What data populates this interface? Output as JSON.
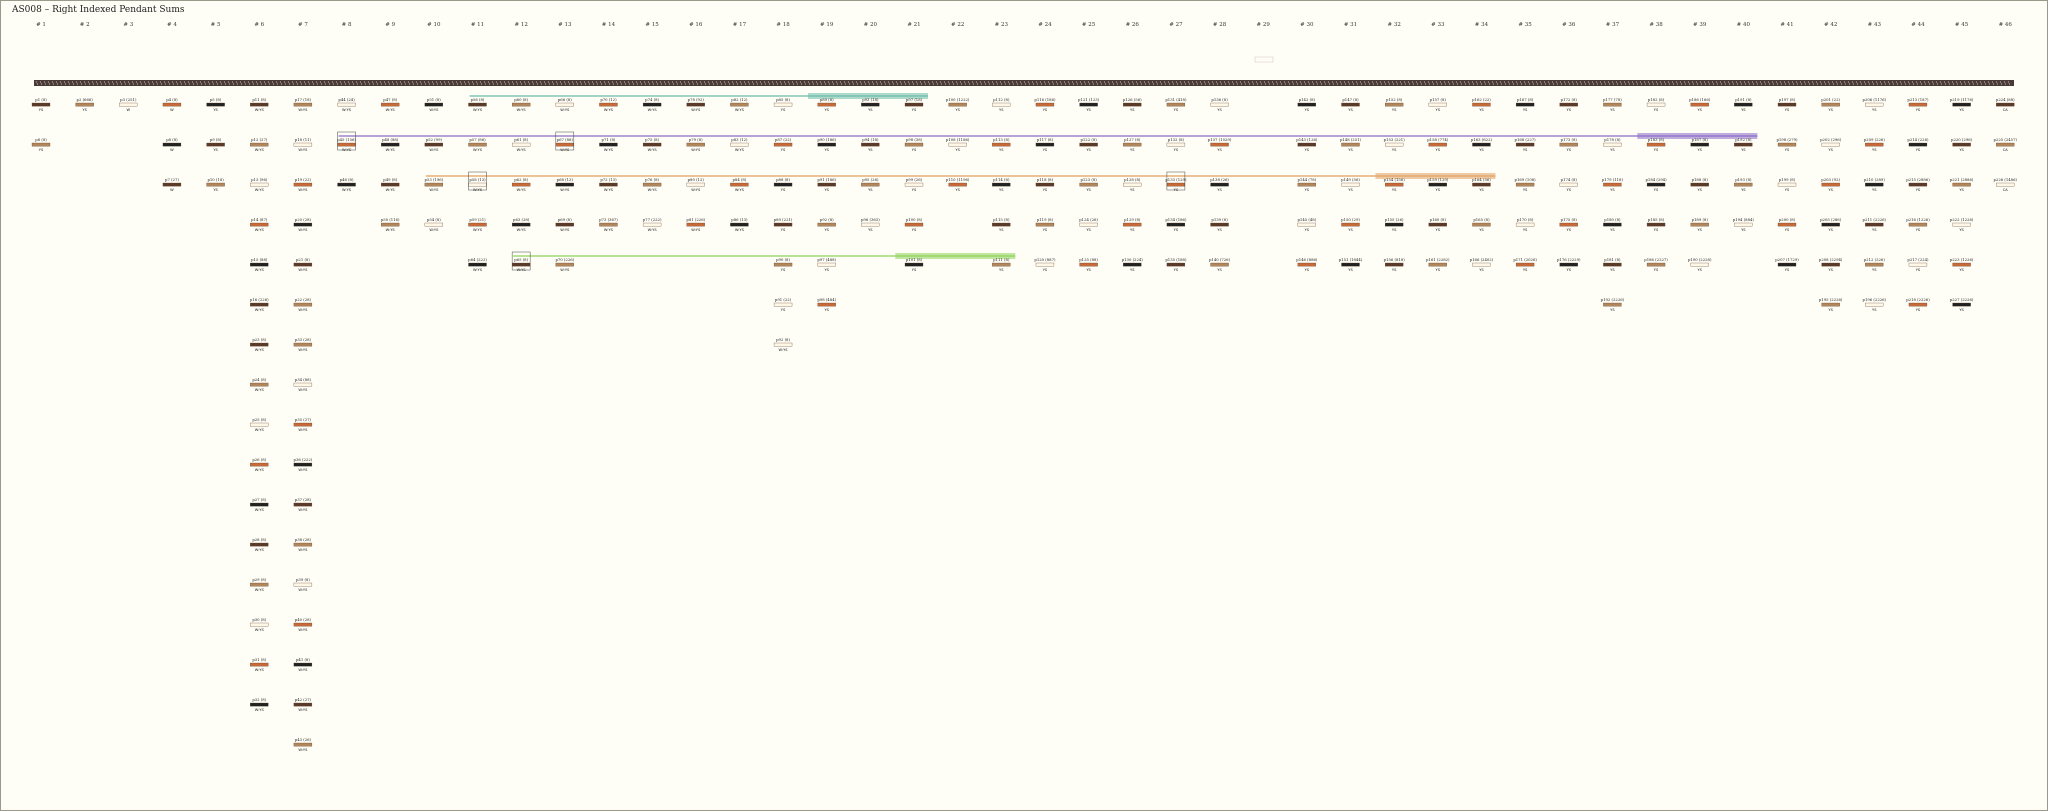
{
  "title": "AS008 – Right Indexed Pendant Sums",
  "colors": {
    "background": "#fffef6",
    "primary_cord": "#4a3a36",
    "dark_brown": "#5b3a2a",
    "light_brown": "#b0865a",
    "cream": "#fff7e6",
    "rust": "#c66a3a",
    "teal": "#6bbcaa",
    "purple": "#8a6cc8",
    "orange": "#e0a060",
    "green": "#8ed25a",
    "black": "#222222"
  },
  "columns": [
    "# 1",
    "# 2",
    "# 3",
    "# 4",
    "# 5",
    "# 6",
    "# 7",
    "# 8",
    "# 9",
    "# 10",
    "# 11",
    "# 12",
    "# 13",
    "# 14",
    "# 15",
    "# 16",
    "# 17",
    "# 18",
    "# 19",
    "# 20",
    "# 21",
    "# 22",
    "# 23",
    "# 24",
    "# 25",
    "# 26",
    "# 27",
    "# 28",
    "# 29",
    "# 30",
    "# 31",
    "# 32",
    "# 33",
    "# 34",
    "# 35",
    "# 36",
    "# 37",
    "# 38",
    "# 39",
    "# 40",
    "# 41",
    "# 42",
    "# 43",
    "# 44",
    "# 45",
    "# 46"
  ],
  "row1_labels": [
    "p1 (8)",
    "p2 (666)",
    "p3 (251)",
    "p4 (8)",
    "p5 (8)",
    "p11 (8)",
    "p17 (18)",
    "p44 (24)",
    "p47 (8)",
    "p51 (8)",
    "p56 (8)",
    "p60 (8)",
    "p66 (8)",
    "p70 (12)",
    "p74 (8)",
    "p78 (92)",
    "p82 (12)",
    "p85 (8)",
    "p89 (8)",
    "p93 (18)",
    "p97 (18)",
    "p100 (1222)",
    "p112 (8)",
    "p116 (186)",
    "p121 (123)",
    "p126 (56)",
    "p131 (418)",
    "p136 (8)",
    "",
    "p142 (8)",
    "p147 (8)",
    "p152 (8)",
    "p157 (8)",
    "p162 (22)",
    "p167 (8)",
    "p172 (8)",
    "p177 (78)",
    "p182 (8)",
    "p186 (166)",
    "p191 (8)",
    "p197 (8)",
    "p201 (22)",
    "p206 (1176)",
    "p213 (187)",
    "p219 (1176)",
    "p224 (88)"
  ],
  "row2_labels": [
    "p6 (8)",
    "",
    "",
    "p8 (8)",
    "p9 (8)",
    "p12 (27)",
    "p18 (11)",
    "p45 (156)",
    "p48 (88)",
    "p52 (99)",
    "p57 (86)",
    "p61 (8)",
    "p67 (88)",
    "p71 (8)",
    "p75 (8)",
    "p79 (8)",
    "p83 (12)",
    "p87 (22)",
    "p90 (186)",
    "p94 (18)",
    "p98 (38)",
    "p108 (1186)",
    "p113 (8)",
    "p117 (8)",
    "p122 (8)",
    "p127 (8)",
    "p132 (8)",
    "p137 (1029)",
    "",
    "p143 (126)",
    "p148 (251)",
    "p153 (221)",
    "p158 (774)",
    "p163 (622)",
    "p168 (227)",
    "p173 (8)",
    "p178 (8)",
    "p183 (8)",
    "p187 (8)",
    "p192 (8)",
    "p198 (279)",
    "p202 (296)",
    "p209 (226)",
    "p214 (226)",
    "p220 (296)",
    "p225 (2457)"
  ],
  "row3_labels": [
    "",
    "",
    "",
    "p7 (27)",
    "p10 (18)",
    "p13 (96)",
    "p19 (22)",
    "p46 (8)",
    "p49 (8)",
    "p53 (196)",
    "p58 (13)",
    "p62 (8)",
    "p68 (13)",
    "p72 (13)",
    "p76 (8)",
    "p80 (12)",
    "p84 (8)",
    "p88 (8)",
    "p91 (186)",
    "p95 (26)",
    "p99 (26)",
    "p110 (1196)",
    "p114 (8)",
    "p118 (8)",
    "p123 (8)",
    "p128 (8)",
    "p133 (129)",
    "p138 (26)",
    "",
    "p144 (78)",
    "p149 (56)",
    "p154 (156)",
    "p159 (129)",
    "p164 (56)",
    "p169 (108)",
    "p174 (8)",
    "p179 (118)",
    "p184 (294)",
    "p188 (8)",
    "p193 (8)",
    "p199 (8)",
    "p203 (92)",
    "p210 (289)",
    "p215 (2886)",
    "p221 (2886)",
    "p226 (1486)"
  ],
  "row4_labels": [
    "",
    "",
    "",
    "",
    "",
    "p14 (87)",
    "p20 (28)",
    "",
    "p50 (116)",
    "p54 (8)",
    "p59 (21)",
    "p63 (28)",
    "p69 (8)",
    "p73 (367)",
    "p77 (222)",
    "p81 (226)",
    "p86 (13)",
    "p89 (221)",
    "p92 (8)",
    "p96 (363)",
    "p100 (8)",
    "",
    "p115 (8)",
    "p119 (8)",
    "p124 (26)",
    "p129 (8)",
    "p134 (186)",
    "p139 (8)",
    "",
    "p145 (48)",
    "p150 (29)",
    "p155 (26)",
    "p160 (8)",
    "p165 (8)",
    "p170 (8)",
    "p175 (8)",
    "p180 (8)",
    "p185 (8)",
    "p189 (8)",
    "p194 (884)",
    "p200 (8)",
    "p205 (286)",
    "p211 (2226)",
    "p216 (1226)",
    "p222 (1226)",
    ""
  ],
  "row5_labels": [
    "",
    "",
    "",
    "",
    "",
    "p15 (88)",
    "p21 (8)",
    "",
    "",
    "",
    "p64 (222)",
    "p65 (8)",
    "p70 (226)",
    "",
    "",
    "",
    "",
    "p90 (8)",
    "p97 (488)",
    "",
    "p101 (8)",
    "",
    "p111 (8)",
    "p120 (887)",
    "p125 (88)",
    "p130 (224)",
    "p135 (188)",
    "p140 (726)",
    "",
    "p146 (886)",
    "p151 (1844)",
    "p156 (818)",
    "p161 (2282)",
    "p166 (2402)",
    "p171 (2026)",
    "p176 (2229)",
    "p181 (8)",
    "p186 (2227)",
    "p190 (2228)",
    "",
    "p207 (1729)",
    "p208 (2294)",
    "p212 (226)",
    "p217 (224)",
    "p223 (1226)",
    ""
  ],
  "row6_labels": [
    "",
    "",
    "",
    "",
    "",
    "p16 (226)",
    "p22 (28)",
    "",
    "",
    "",
    "",
    "",
    "",
    "",
    "",
    "",
    "",
    "p91 (22)",
    "p98 (484)",
    "",
    "",
    "",
    "",
    "",
    "",
    "",
    "",
    "",
    "",
    "",
    "",
    "",
    "",
    "",
    "",
    "",
    "p192 (2226)",
    "",
    "",
    "",
    "",
    "p195 (2226)",
    "p196 (2226)",
    "p218 (2226)",
    "p227 (2226)",
    ""
  ],
  "col6_extra": [
    "p23 (8)",
    "p24 (8)",
    "p25 (8)",
    "p26 (8)",
    "p27 (8)",
    "p28 (8)",
    "p29 (8)",
    "p30 (8)",
    "p31 (8)",
    "p32 (8)"
  ],
  "col7_extra": [
    "p33 (28)",
    "p34 (88)",
    "p35 (27)",
    "p36 (222)",
    "p37 (28)",
    "p38 (28)",
    "p39 (8)",
    "p40 (28)",
    "p41 (8)",
    "p42 (27)",
    "p43 (26)"
  ],
  "col18_extra": "p92 (8)",
  "sub_texts": [
    "YS",
    "YS",
    "W",
    "W",
    "YS",
    "W:YS",
    "W:YS",
    "W:YS",
    "W:YS",
    "W:YS",
    "W:YS",
    "W:YS",
    "W:YS",
    "W:YS",
    "W:YS",
    "W:YS",
    "W:YS",
    "YS",
    "YS",
    "YS",
    "YS",
    "YS",
    "YS",
    "YS",
    "YS",
    "YS",
    "YS",
    "YS",
    "YS",
    "YS",
    "YS",
    "YS",
    "YS",
    "YS",
    "YS",
    "YS",
    "YS",
    "YS",
    "YS",
    "YS",
    "YS",
    "YS",
    "YS",
    "YS",
    "YS",
    "CA"
  ],
  "top_ghost_label": "",
  "bands": [
    {
      "name": "teal-band",
      "color": "#6bbcaa",
      "from_col": 11,
      "to_col": 21,
      "row": 1
    },
    {
      "name": "purple-band",
      "color": "#8a6cc8",
      "from_col": 8,
      "to_col": 40,
      "row": 2
    },
    {
      "name": "orange-band",
      "color": "#e0a060",
      "from_col": 10,
      "to_col": 34,
      "row": 3
    },
    {
      "name": "green-band",
      "color": "#8ed25a",
      "from_col": 12,
      "to_col": 23,
      "row": 5
    }
  ]
}
